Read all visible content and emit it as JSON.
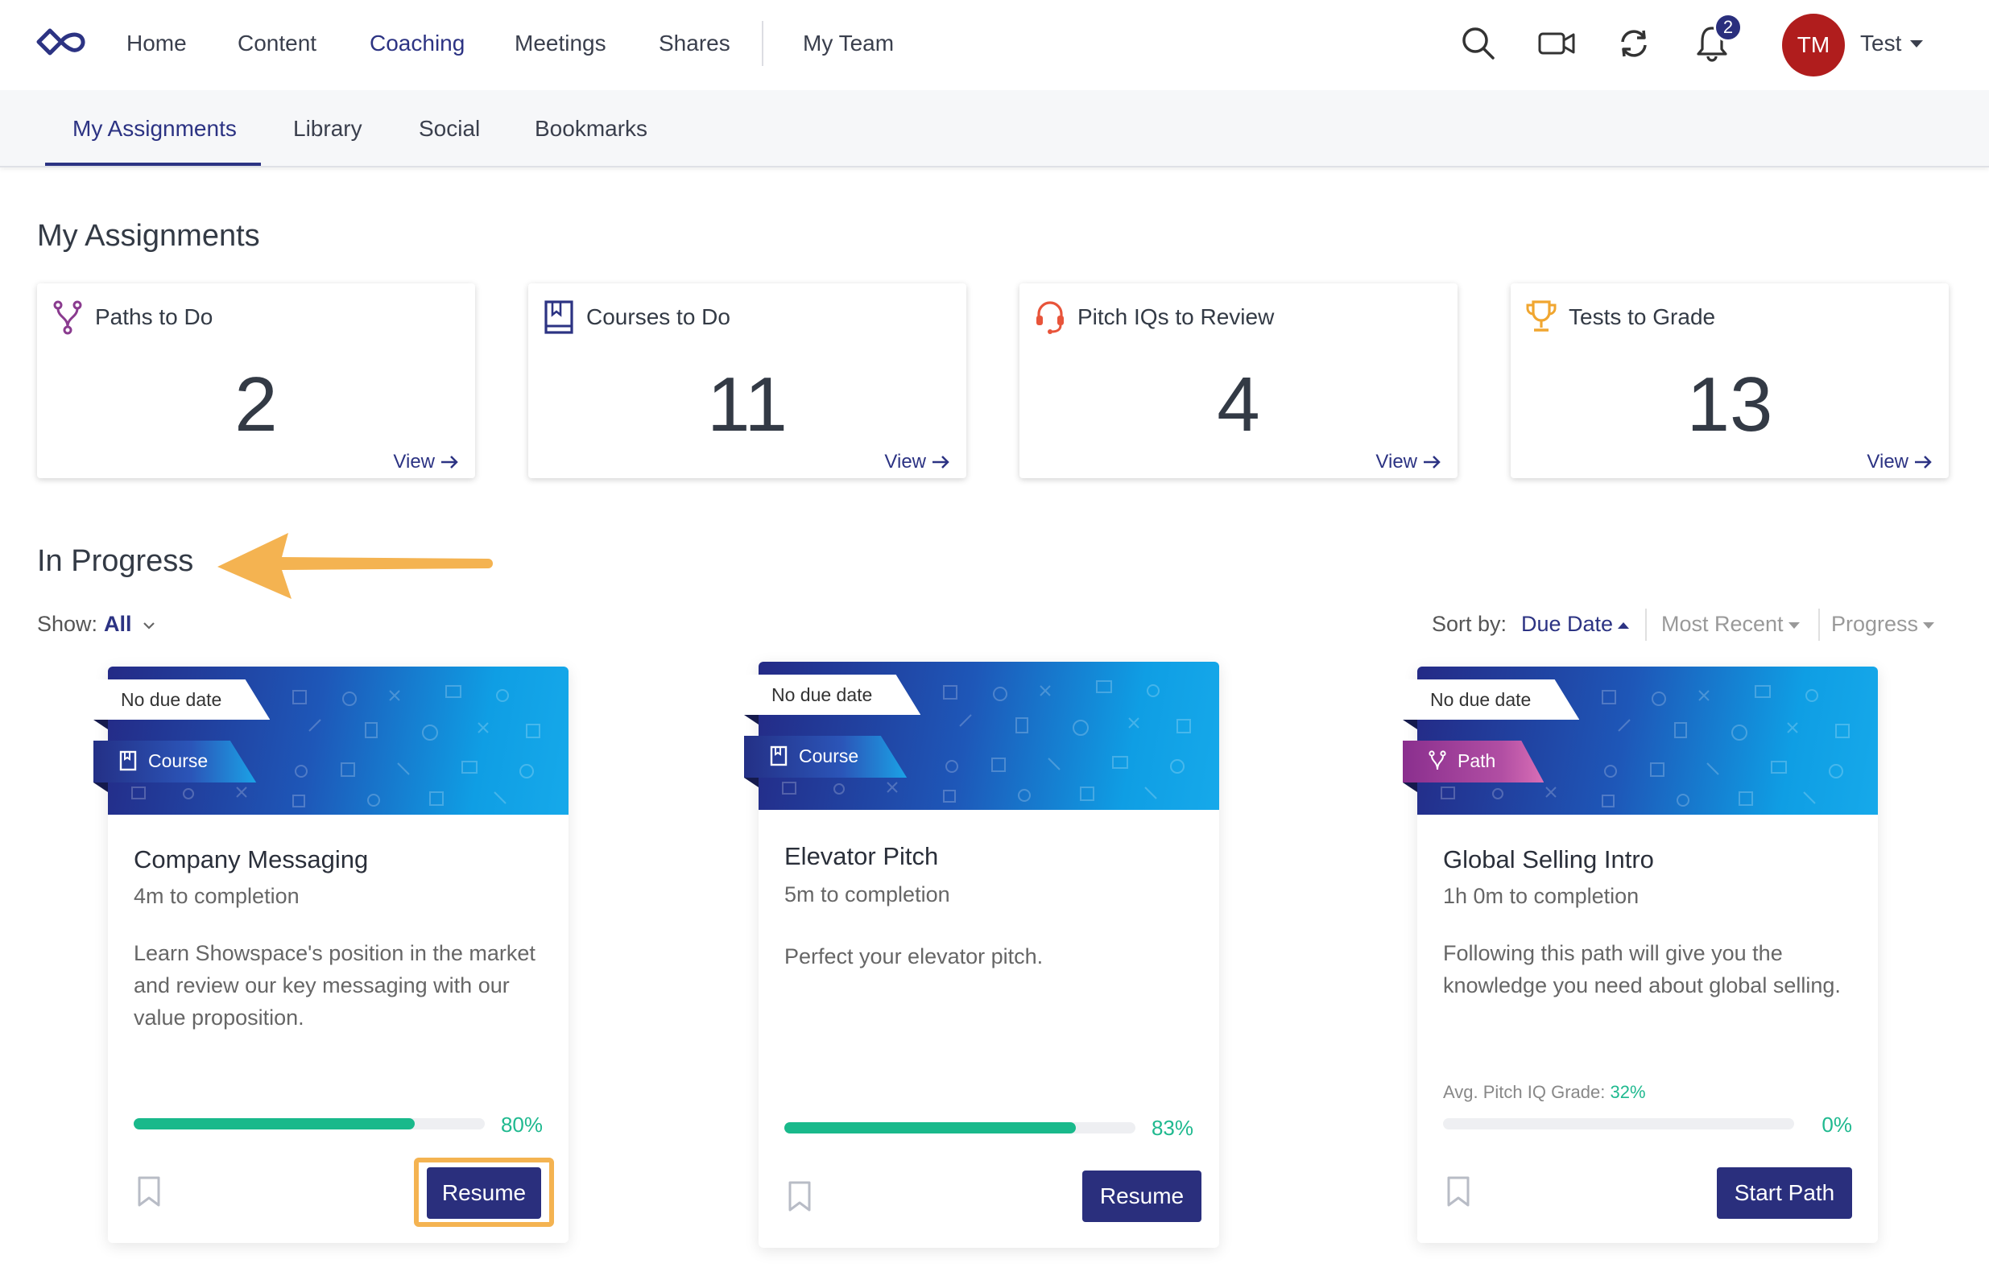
{
  "topnav": {
    "logo": "infinity-logo-icon",
    "items": [
      {
        "label": "Home"
      },
      {
        "label": "Content"
      },
      {
        "label": "Coaching",
        "active": true
      },
      {
        "label": "Meetings"
      },
      {
        "label": "Shares"
      },
      {
        "label": "My Team"
      }
    ],
    "icons": [
      "search-icon",
      "video-camera-icon",
      "sync-icon",
      "bell-icon"
    ],
    "notifications_count": "2",
    "user": {
      "initials": "TM",
      "name": "Test"
    }
  },
  "subnav": {
    "items": [
      {
        "label": "My Assignments",
        "active": true
      },
      {
        "label": "Library"
      },
      {
        "label": "Social"
      },
      {
        "label": "Bookmarks"
      }
    ]
  },
  "page": {
    "title": "My Assignments",
    "stats": [
      {
        "label": "Paths to Do",
        "value": "2",
        "view": "View",
        "icon": "path-fork-icon",
        "icon_color": "#8a3b8f"
      },
      {
        "label": "Courses to Do",
        "value": "11",
        "view": "View",
        "icon": "book-icon",
        "icon_color": "#2c3383"
      },
      {
        "label": "Pitch IQs to Review",
        "value": "4",
        "view": "View",
        "icon": "headset-icon",
        "icon_color": "#e8543a"
      },
      {
        "label": "Tests to Grade",
        "value": "13",
        "view": "View",
        "icon": "trophy-icon",
        "icon_color": "#f0a630"
      }
    ],
    "in_progress": {
      "title": "In Progress",
      "show_label": "Show:",
      "show_value": "All",
      "sort_label": "Sort by:",
      "sort_options": [
        {
          "label": "Due Date",
          "active": true
        },
        {
          "label": "Most Recent"
        },
        {
          "label": "Progress"
        }
      ]
    },
    "cards": [
      {
        "due": "No due date",
        "type": "Course",
        "title": "Company Messaging",
        "duration": "4m to completion",
        "description": "Learn Showspace's position in the market and review our key messaging with our value proposition.",
        "progress": 0.8,
        "progress_label": "80%",
        "action": "Resume"
      },
      {
        "due": "No due date",
        "type": "Course",
        "title": "Elevator Pitch",
        "duration": "5m to completion",
        "description": "Perfect your elevator pitch.",
        "progress": 0.83,
        "progress_label": "83%",
        "action": "Resume"
      },
      {
        "due": "No due date",
        "type": "Path",
        "title": "Global Selling Intro",
        "duration": "1h 0m to completion",
        "description": "Following this path will give you the knowledge you need about global selling.",
        "grade_label": "Avg. Pitch IQ Grade:",
        "grade_value": "32%",
        "progress": 0,
        "progress_label": "0%",
        "action": "Start Path"
      }
    ]
  },
  "colors": {
    "brand": "#2c3383",
    "progress": "#19b98b",
    "highlight": "#f4b351",
    "avatar": "#b01d1d"
  }
}
